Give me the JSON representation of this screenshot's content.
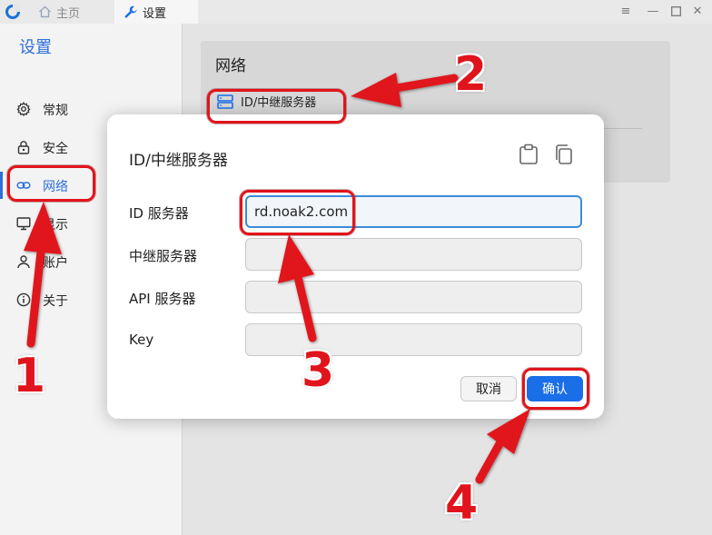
{
  "titlebar": {
    "tabs": [
      {
        "label": "主页",
        "icon": "home-icon"
      },
      {
        "label": "设置",
        "icon": "wrench-icon"
      }
    ],
    "controls": [
      "menu-icon",
      "minimize-icon",
      "maximize-icon",
      "close-icon"
    ]
  },
  "sidebar": {
    "title": "设置",
    "items": [
      {
        "label": "常规",
        "icon": "gear-icon"
      },
      {
        "label": "安全",
        "icon": "lock-icon"
      },
      {
        "label": "网络",
        "icon": "link-icon",
        "active": true
      },
      {
        "label": "显示",
        "icon": "monitor-icon"
      },
      {
        "label": "账户",
        "icon": "user-icon"
      },
      {
        "label": "关于",
        "icon": "info-icon"
      }
    ]
  },
  "main": {
    "card_title": "网络",
    "server_link_label": "ID/中继服务器"
  },
  "dialog": {
    "title": "ID/中继服务器",
    "fields": [
      {
        "label": "ID 服务器",
        "value": "rd.noak2.com"
      },
      {
        "label": "中继服务器",
        "value": ""
      },
      {
        "label": "API 服务器",
        "value": ""
      },
      {
        "label": "Key",
        "value": ""
      }
    ],
    "cancel_label": "取消",
    "ok_label": "确认"
  },
  "annotations": {
    "numbers": [
      "1",
      "2",
      "3",
      "4"
    ],
    "color": "#e0141c"
  },
  "colors": {
    "accent": "#2e6fd8",
    "primary_button": "#1a6ee8",
    "annotation_red": "#e0141c"
  }
}
